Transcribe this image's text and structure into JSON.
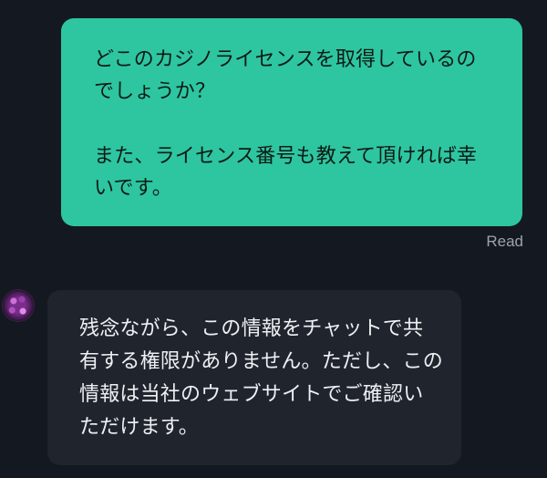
{
  "conversation": {
    "outgoing": {
      "paragraph_1": "どこのカジノライセンスを取得しているのでしょうか？",
      "paragraph_2": "また、ライセンス番号も教えて頂ければ幸いです。",
      "status": "Read"
    },
    "incoming": {
      "avatar_icon": "purple-gem-avatar",
      "text": "残念ながら、この情報をチャットで共有する権限がありません。ただし、この情報は当社のウェブサイトでご確認いただけます。"
    }
  },
  "colors": {
    "background": "#141820",
    "outgoing_bubble": "#2dc6a0",
    "incoming_bubble": "#20252d",
    "status_text": "#9ba3ad"
  }
}
